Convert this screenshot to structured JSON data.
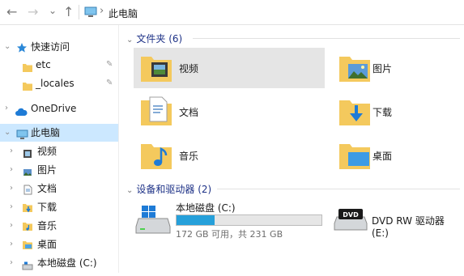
{
  "address": {
    "back": "←",
    "forward": "→",
    "dropdown": "⌄",
    "up": "↑",
    "crumb_sep": "›",
    "location": "此电脑"
  },
  "nav": {
    "quick_access": "快速访问",
    "quick_items": [
      {
        "label": "etc",
        "pinned": true
      },
      {
        "label": "_locales",
        "pinned": true
      }
    ],
    "onedrive": "OneDrive",
    "this_pc": "此电脑",
    "pc_items": [
      "视频",
      "图片",
      "文档",
      "下载",
      "音乐",
      "桌面",
      "本地磁盘 (C:)"
    ]
  },
  "content": {
    "folders_header": "文件夹 (6)",
    "folders": [
      {
        "label": "视频",
        "icon": "video-folder-icon",
        "selected": true
      },
      {
        "label": "图片",
        "icon": "pictures-folder-icon"
      },
      {
        "label": "文档",
        "icon": "documents-folder-icon"
      },
      {
        "label": "下载",
        "icon": "downloads-folder-icon"
      },
      {
        "label": "音乐",
        "icon": "music-folder-icon"
      },
      {
        "label": "桌面",
        "icon": "desktop-folder-icon"
      }
    ],
    "devices_header": "设备和驱动器 (2)",
    "drives": [
      {
        "name": "本地磁盘 (C:)",
        "free": "172 GB 可用，共 231 GB",
        "used_fraction": 0.26
      },
      {
        "name": "DVD RW 驱动器 (E:)",
        "badge": "DVD"
      }
    ]
  },
  "colors": {
    "accent": "#26a0da",
    "selection": "#cce8ff",
    "folder": "#f4c95d",
    "section": "#1e3287"
  }
}
